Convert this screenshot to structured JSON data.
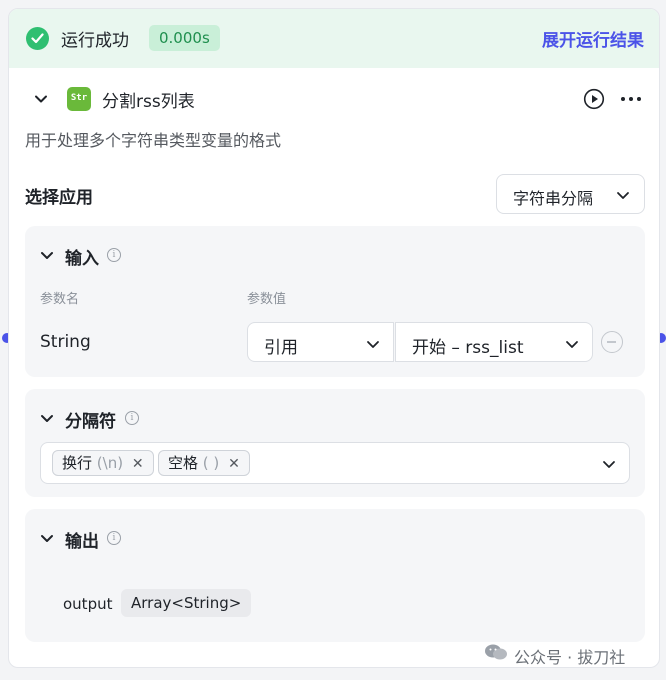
{
  "status": {
    "text": "运行成功",
    "duration": "0.000s",
    "expand_link": "展开运行结果"
  },
  "node": {
    "icon_label": "Str",
    "title": "分割rss列表",
    "description": "用于处理多个字符串类型变量的格式"
  },
  "select_app": {
    "label": "选择应用",
    "value": "字符串分隔"
  },
  "input_panel": {
    "title": "输入",
    "col_name": "参数名",
    "col_value": "参数值",
    "param_name": "String",
    "ref_type": "引用",
    "ref_value": "开始 – rss_list"
  },
  "separator_panel": {
    "title": "分隔符",
    "tags": [
      {
        "label": "换行",
        "hint": "(\\n)"
      },
      {
        "label": "空格",
        "hint": "( )"
      }
    ]
  },
  "output_panel": {
    "title": "输出",
    "name": "output",
    "type": "Array<String>"
  },
  "watermark": "公众号 · 拔刀社",
  "colors": {
    "accent": "#4b53e8",
    "success": "#2fbf71",
    "status_bg": "#e9f7ef"
  }
}
